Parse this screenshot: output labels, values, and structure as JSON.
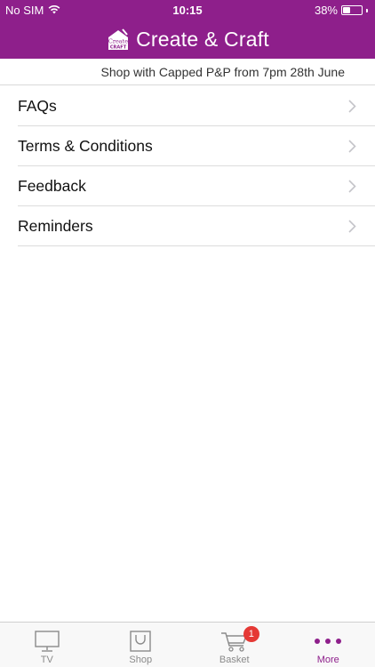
{
  "status_bar": {
    "carrier": "No SIM",
    "time": "10:15",
    "battery": "38%",
    "battery_level": 0.38
  },
  "header": {
    "title": "Create & Craft",
    "logo_text_top": "Create",
    "logo_text_bottom": "CRAFT"
  },
  "banner": {
    "text": "Shop with Capped P&P from 7pm 28th June"
  },
  "menu": {
    "items": [
      {
        "label": "FAQs"
      },
      {
        "label": "Terms & Conditions"
      },
      {
        "label": "Feedback"
      },
      {
        "label": "Reminders"
      }
    ]
  },
  "tab_bar": {
    "tabs": [
      {
        "label": "TV",
        "icon": "tv-icon"
      },
      {
        "label": "Shop",
        "icon": "shopping-bag-icon"
      },
      {
        "label": "Basket",
        "icon": "cart-icon",
        "badge": "1"
      },
      {
        "label": "More",
        "icon": "more-dots-icon",
        "active": true
      }
    ]
  },
  "colors": {
    "brand": "#8e1f8b",
    "badge": "#e53935",
    "inactive": "#8a8a8a"
  }
}
